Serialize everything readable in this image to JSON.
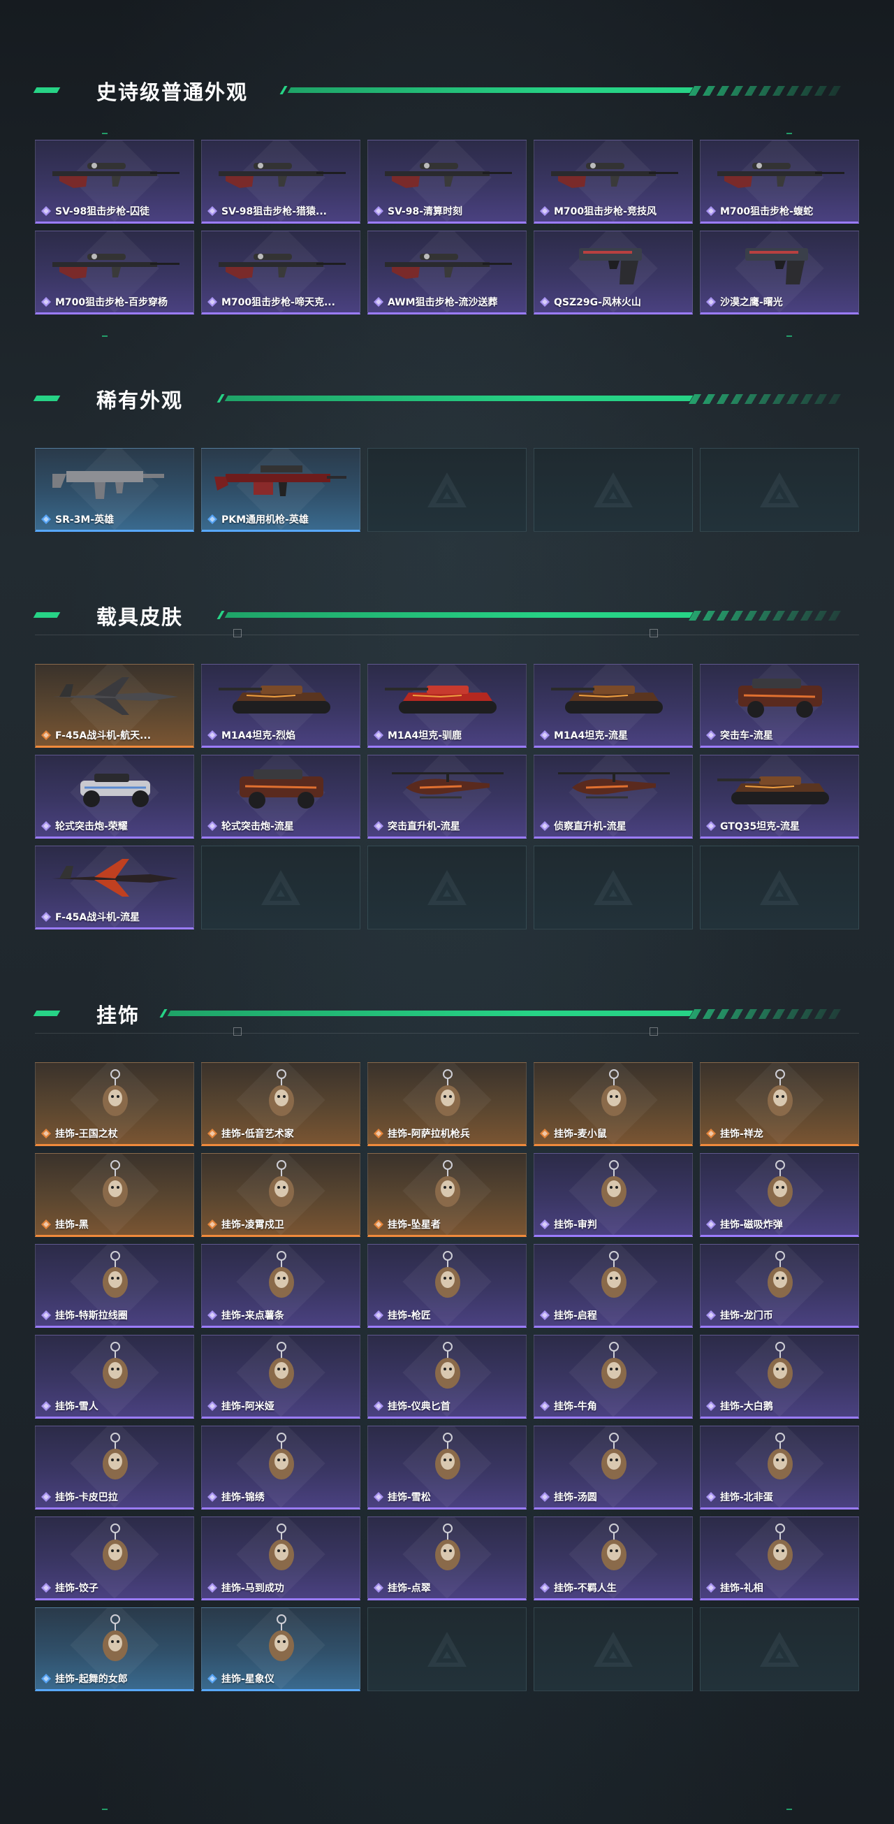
{
  "colors": {
    "accent": "#27d386",
    "epic": "#9b7cff",
    "legendary": "#f08a3c",
    "rare": "#58a8ff",
    "background": "#1b2127"
  },
  "sections": [
    {
      "title": "史诗级普通外观",
      "items": [
        {
          "label": "SV-98狙击步枪-囚徒",
          "rarity": "purple",
          "kind": "sniper"
        },
        {
          "label": "SV-98狙击步枪-猎猿...",
          "rarity": "purple",
          "kind": "sniper"
        },
        {
          "label": "SV-98-清算时刻",
          "rarity": "purple",
          "kind": "sniper"
        },
        {
          "label": "M700狙击步枪-竞技风",
          "rarity": "purple",
          "kind": "sniper"
        },
        {
          "label": "M700狙击步枪-蝮蛇",
          "rarity": "purple",
          "kind": "sniper"
        },
        {
          "label": "M700狙击步枪-百步穿杨",
          "rarity": "purple",
          "kind": "sniper"
        },
        {
          "label": "M700狙击步枪-啼天克...",
          "rarity": "purple",
          "kind": "sniper"
        },
        {
          "label": "AWM狙击步枪-流沙送葬",
          "rarity": "purple",
          "kind": "sniper"
        },
        {
          "label": "QSZ29G-风林火山",
          "rarity": "purple",
          "kind": "pistol"
        },
        {
          "label": "沙漠之鹰-曙光",
          "rarity": "purple",
          "kind": "pistol"
        }
      ]
    },
    {
      "title": "稀有外观",
      "items": [
        {
          "label": "SR-3M-英雄",
          "rarity": "blue",
          "kind": "smg"
        },
        {
          "label": "PKM通用机枪-英雄",
          "rarity": "blue",
          "kind": "lmg"
        },
        {
          "label": "",
          "rarity": "empty",
          "kind": "empty"
        },
        {
          "label": "",
          "rarity": "empty",
          "kind": "empty"
        },
        {
          "label": "",
          "rarity": "empty",
          "kind": "empty"
        }
      ]
    },
    {
      "title": "载具皮肤",
      "items": [
        {
          "label": "F-45A战斗机-航天...",
          "rarity": "orange",
          "kind": "jet"
        },
        {
          "label": "M1A4坦克-烈焰",
          "rarity": "purple",
          "kind": "tank"
        },
        {
          "label": "M1A4坦克-驯鹿",
          "rarity": "purple",
          "kind": "tank-red"
        },
        {
          "label": "M1A4坦克-流星",
          "rarity": "purple",
          "kind": "tank"
        },
        {
          "label": "突击车-流星",
          "rarity": "purple",
          "kind": "truck"
        },
        {
          "label": "轮式突击炮-荣耀",
          "rarity": "purple",
          "kind": "buggy"
        },
        {
          "label": "轮式突击炮-流星",
          "rarity": "purple",
          "kind": "truck"
        },
        {
          "label": "突击直升机-流星",
          "rarity": "purple",
          "kind": "heli"
        },
        {
          "label": "侦察直升机-流星",
          "rarity": "purple",
          "kind": "heli"
        },
        {
          "label": "GTQ35坦克-流星",
          "rarity": "purple",
          "kind": "tank"
        },
        {
          "label": "F-45A战斗机-流星",
          "rarity": "purple",
          "kind": "jet-red"
        },
        {
          "label": "",
          "rarity": "empty",
          "kind": "empty"
        },
        {
          "label": "",
          "rarity": "empty",
          "kind": "empty"
        },
        {
          "label": "",
          "rarity": "empty",
          "kind": "empty"
        },
        {
          "label": "",
          "rarity": "empty",
          "kind": "empty"
        }
      ]
    },
    {
      "title": "挂饰",
      "items": [
        {
          "label": "挂饰-王国之杖",
          "rarity": "orange",
          "kind": "charm"
        },
        {
          "label": "挂饰-低音艺术家",
          "rarity": "orange",
          "kind": "charm"
        },
        {
          "label": "挂饰-阿萨拉机枪兵",
          "rarity": "orange",
          "kind": "charm"
        },
        {
          "label": "挂饰-麦小鼠",
          "rarity": "orange",
          "kind": "charm"
        },
        {
          "label": "挂饰-祥龙",
          "rarity": "orange",
          "kind": "charm"
        },
        {
          "label": "挂饰-黑",
          "rarity": "orange",
          "kind": "charm"
        },
        {
          "label": "挂饰-凌霄戍卫",
          "rarity": "orange",
          "kind": "charm"
        },
        {
          "label": "挂饰-坠星者",
          "rarity": "orange",
          "kind": "charm"
        },
        {
          "label": "挂饰-审判",
          "rarity": "purple",
          "kind": "charm"
        },
        {
          "label": "挂饰-磁吸炸弹",
          "rarity": "purple",
          "kind": "charm"
        },
        {
          "label": "挂饰-特斯拉线圈",
          "rarity": "purple",
          "kind": "charm"
        },
        {
          "label": "挂饰-来点薯条",
          "rarity": "purple",
          "kind": "charm"
        },
        {
          "label": "挂饰-枪匠",
          "rarity": "purple",
          "kind": "charm"
        },
        {
          "label": "挂饰-启程",
          "rarity": "purple",
          "kind": "charm"
        },
        {
          "label": "挂饰-龙门币",
          "rarity": "purple",
          "kind": "charm"
        },
        {
          "label": "挂饰-雪人",
          "rarity": "purple",
          "kind": "charm"
        },
        {
          "label": "挂饰-阿米娅",
          "rarity": "purple",
          "kind": "charm"
        },
        {
          "label": "挂饰-仪典匕首",
          "rarity": "purple",
          "kind": "charm"
        },
        {
          "label": "挂饰-牛角",
          "rarity": "purple",
          "kind": "charm"
        },
        {
          "label": "挂饰-大白鹅",
          "rarity": "purple",
          "kind": "charm"
        },
        {
          "label": "挂饰-卡皮巴拉",
          "rarity": "purple",
          "kind": "charm"
        },
        {
          "label": "挂饰-锦绣",
          "rarity": "purple",
          "kind": "charm"
        },
        {
          "label": "挂饰-雪松",
          "rarity": "purple",
          "kind": "charm"
        },
        {
          "label": "挂饰-汤圆",
          "rarity": "purple",
          "kind": "charm"
        },
        {
          "label": "挂饰-北非蛋",
          "rarity": "purple",
          "kind": "charm"
        },
        {
          "label": "挂饰-饺子",
          "rarity": "purple",
          "kind": "charm"
        },
        {
          "label": "挂饰-马到成功",
          "rarity": "purple",
          "kind": "charm"
        },
        {
          "label": "挂饰-点翠",
          "rarity": "purple",
          "kind": "charm"
        },
        {
          "label": "挂饰-不羁人生",
          "rarity": "purple",
          "kind": "charm"
        },
        {
          "label": "挂饰-礼相",
          "rarity": "purple",
          "kind": "charm"
        },
        {
          "label": "挂饰-起舞的女郎",
          "rarity": "blue",
          "kind": "charm"
        },
        {
          "label": "挂饰-星象仪",
          "rarity": "blue",
          "kind": "charm"
        },
        {
          "label": "",
          "rarity": "empty",
          "kind": "empty"
        },
        {
          "label": "",
          "rarity": "empty",
          "kind": "empty"
        },
        {
          "label": "",
          "rarity": "empty",
          "kind": "empty"
        }
      ]
    }
  ]
}
